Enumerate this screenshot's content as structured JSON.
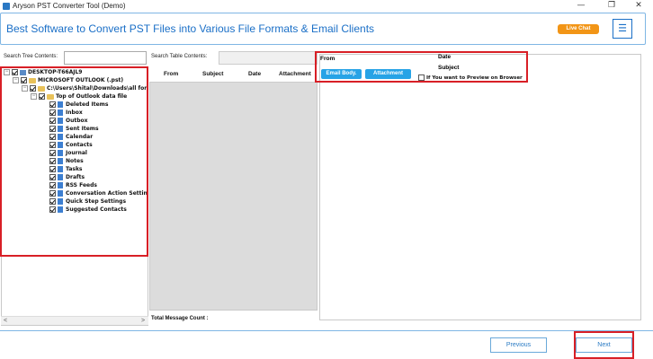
{
  "window": {
    "title": "Aryson PST Converter Tool (Demo)",
    "minimize_glyph": "—",
    "restore_glyph": "❐",
    "close_glyph": "✕"
  },
  "banner": {
    "title": "Best Software to Convert PST Files into Various File Formats & Email Clients",
    "live_chat": "Live Chat",
    "menu_glyph": "☰"
  },
  "tree": {
    "search_label": "Search Tree Contents:",
    "items": [
      {
        "label": "DESKTOP-T66AJL9",
        "icon": "computer-icon"
      },
      {
        "label": "MICROSOFT OUTLOOK (.pst)",
        "icon": "folder-icon"
      },
      {
        "label": "C:\\Users\\Shital\\Downloads\\all for",
        "icon": "folder-icon"
      },
      {
        "label": "Top of Outlook data file",
        "icon": "folder-icon"
      },
      {
        "label": "Deleted Items",
        "icon": "folder-icon"
      },
      {
        "label": "Inbox",
        "icon": "folder-icon"
      },
      {
        "label": "Outbox",
        "icon": "folder-icon"
      },
      {
        "label": "Sent Items",
        "icon": "folder-icon"
      },
      {
        "label": "Calendar",
        "icon": "folder-icon"
      },
      {
        "label": "Contacts",
        "icon": "folder-icon"
      },
      {
        "label": "Journal",
        "icon": "folder-icon"
      },
      {
        "label": "Notes",
        "icon": "folder-icon"
      },
      {
        "label": "Tasks",
        "icon": "folder-icon"
      },
      {
        "label": "Drafts",
        "icon": "folder-icon"
      },
      {
        "label": "RSS Feeds",
        "icon": "folder-icon"
      },
      {
        "label": "Conversation Action Settin",
        "icon": "folder-icon"
      },
      {
        "label": "Quick Step Settings",
        "icon": "folder-icon"
      },
      {
        "label": "Suggested Contacts",
        "icon": "folder-icon"
      }
    ],
    "scroll_left": "<",
    "scroll_right": ">"
  },
  "table": {
    "search_label": "Search Table Contents:",
    "columns": [
      "From",
      "Subject",
      "Date",
      "Attachment"
    ],
    "total_label": "Total Message Count :"
  },
  "preview": {
    "from_label": "From",
    "date_label": "Date",
    "subject_label": "Subject",
    "email_body_button": "Email Body.",
    "attachment_button": "Attachment",
    "browser_checkbox_label": "If You want to Preview on Browser"
  },
  "footer": {
    "previous": "Previous",
    "next": "Next"
  },
  "colors": {
    "accent": "#1a6fc7",
    "live_chat": "#f29516",
    "button_blue": "#27a3e6",
    "highlight_red": "#d81f26"
  }
}
